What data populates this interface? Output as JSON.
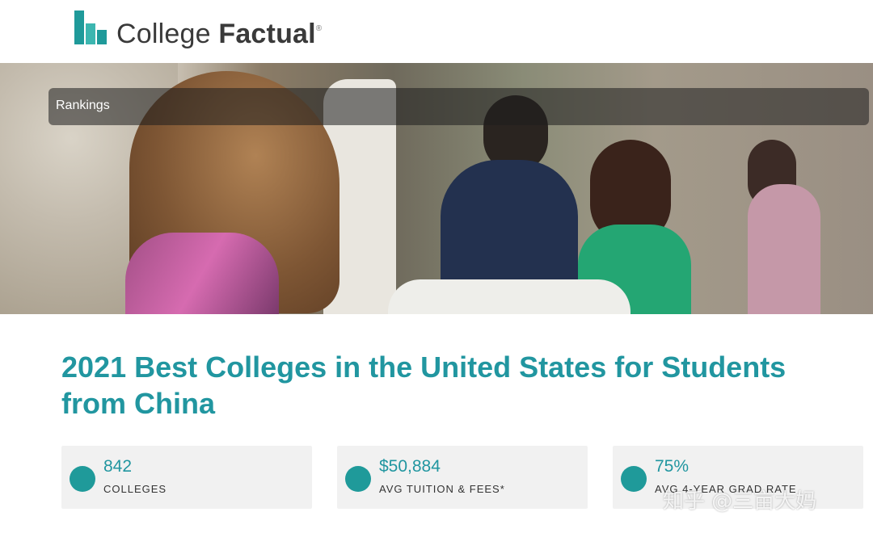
{
  "brand": {
    "name_part1": "College",
    "name_part2": "Factual",
    "registered": "®"
  },
  "nav": {
    "label": "Rankings"
  },
  "page": {
    "title": "2021 Best Colleges in the United States for Students from China"
  },
  "stats": [
    {
      "value": "842",
      "label": "COLLEGES"
    },
    {
      "value": "$50,884",
      "label": "AVG TUITION & FEES*"
    },
    {
      "value": "75%",
      "label": "AVG 4-YEAR GRAD RATE"
    }
  ],
  "watermark": "知乎 @三亩大妈",
  "colors": {
    "accent": "#2196a0",
    "card_bg": "#f1f1f1"
  }
}
